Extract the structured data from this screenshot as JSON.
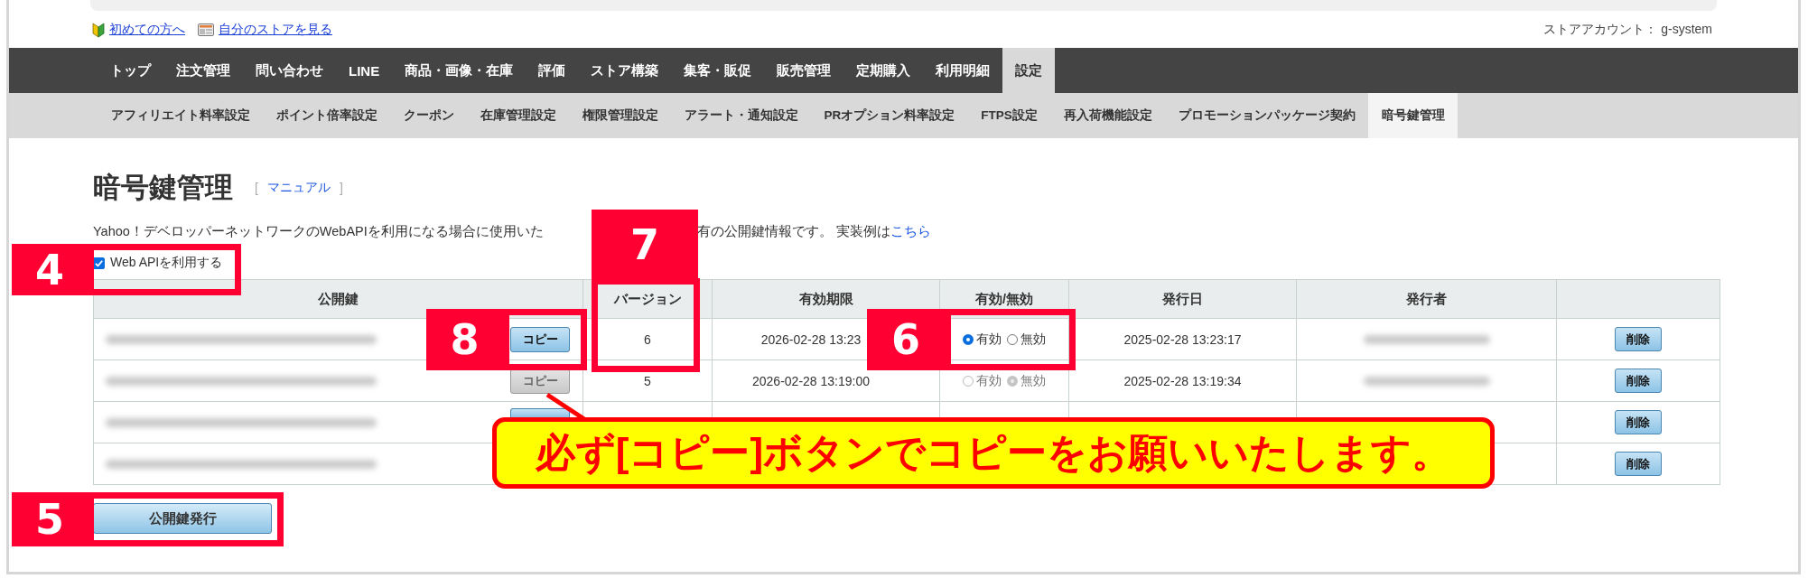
{
  "top_links": [
    {
      "text": "初めての方へ"
    },
    {
      "text": "自分のストアを見る"
    }
  ],
  "account": "ストアアカウント： g-system",
  "main_nav": [
    {
      "label": "トップ",
      "selected": false
    },
    {
      "label": "注文管理",
      "selected": false
    },
    {
      "label": "問い合わせ",
      "selected": false
    },
    {
      "label": "LINE",
      "selected": false
    },
    {
      "label": "商品・画像・在庫",
      "selected": false
    },
    {
      "label": "評価",
      "selected": false
    },
    {
      "label": "ストア構築",
      "selected": false
    },
    {
      "label": "集客・販促",
      "selected": false
    },
    {
      "label": "販売管理",
      "selected": false
    },
    {
      "label": "定期購入",
      "selected": false
    },
    {
      "label": "利用明細",
      "selected": false
    },
    {
      "label": "設定",
      "selected": true
    }
  ],
  "sub_nav": [
    {
      "label": "アフィリエイト料率設定",
      "selected": false
    },
    {
      "label": "ポイント倍率設定",
      "selected": false
    },
    {
      "label": "クーポン",
      "selected": false
    },
    {
      "label": "在庫管理設定",
      "selected": false
    },
    {
      "label": "権限管理設定",
      "selected": false
    },
    {
      "label": "アラート・通知設定",
      "selected": false
    },
    {
      "label": "PRオプション料率設定",
      "selected": false
    },
    {
      "label": "FTPS設定",
      "selected": false
    },
    {
      "label": "再入荷機能設定",
      "selected": false
    },
    {
      "label": "プロモーションパッケージ契約",
      "selected": false
    },
    {
      "label": "暗号鍵管理",
      "selected": true
    }
  ],
  "page_title": "暗号鍵管理",
  "manual_link": {
    "open": "[",
    "label": "マニュアル",
    "close": "]"
  },
  "description": {
    "part_1": "Yahoo！デベロッパーネットワークのWebAPIを利用になる場合に使用いた",
    "part_2": "有の公開鍵情報です。 実装例は",
    "link": "こちら"
  },
  "web_api_checkbox": {
    "label": "Web APIを利用する",
    "checked": true
  },
  "table": {
    "columns": [
      "公開鍵",
      "バージョン",
      "有効期限",
      "有効/無効",
      "発行日",
      "発行者"
    ],
    "rows": [
      {
        "copy": {
          "label": "コピー",
          "disabled": false
        },
        "version": "6",
        "expiry": "2026-02-28 13:23",
        "status": {
          "disabled": false,
          "options": [
            {
              "label": "有効",
              "selected": true
            },
            {
              "label": "無効",
              "selected": false
            }
          ]
        },
        "issued": "2025-02-28 13:23:17",
        "issuer_redacted": true,
        "delete": "削除"
      },
      {
        "copy": {
          "label": "コピー",
          "disabled": true
        },
        "version": "5",
        "expiry": "2026-02-28 13:19:00",
        "status": {
          "disabled": true,
          "options": [
            {
              "label": "有効",
              "selected": false
            },
            {
              "label": "無効",
              "selected": true
            }
          ]
        },
        "issued": "2025-02-28 13:19:34",
        "issuer_redacted": true,
        "delete": "削除"
      },
      {
        "copy": {
          "disabled": false
        },
        "delete": "削除"
      },
      {
        "delete": "削除"
      }
    ]
  },
  "issue_button": "公開鍵発行",
  "callout": "必ず[コピー]ボタンでコピーをお願いいたします。",
  "annotations": [
    {
      "number": "7"
    },
    {
      "number": "4"
    },
    {
      "number": "8"
    },
    {
      "number": "6"
    },
    {
      "number": "5"
    }
  ]
}
